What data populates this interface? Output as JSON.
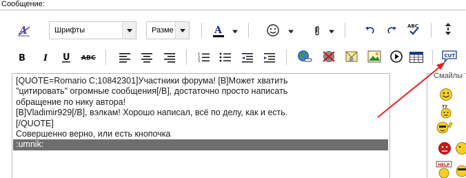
{
  "header": {
    "label": "Сообщение:"
  },
  "toolbar": {
    "font_select": {
      "value": "Шрифты"
    },
    "size_select": {
      "value": "Разме"
    },
    "buttons_row1": [
      "remove-format",
      "font-color",
      "smilies",
      "attach",
      "undo",
      "redo",
      "spellcheck",
      "resize"
    ],
    "buttons_row2": [
      "bold",
      "italic",
      "underline",
      "strikethrough",
      "align-left",
      "align-center",
      "align-right",
      "ordered-list",
      "unordered-list",
      "indent",
      "outdent",
      "insert-link",
      "remove-link",
      "email",
      "insert-image",
      "insert-video",
      "table",
      "cut"
    ],
    "cut_label": "CUT"
  },
  "editor": {
    "lines": [
      "[QUOTE=Romario C;10842301]Участники форума! [B]Может хватить",
      "\"цитировать\" огромные сообщения[/B], достаточно просто написать",
      "обращение по нику автора!",
      "[B]Vladimir929[/B], вэлкам! Хорошо написал, всё по делу, как и есть.",
      "[/QUOTE]",
      "Совершенно верно, или есть кнопочка",
      ":umnik:"
    ]
  },
  "smilies_panel": {
    "title": "Смайлы"
  },
  "annotation": {
    "arrow_color": "#e8201c"
  },
  "colors": {
    "selection": "#6e6e6e",
    "border": "#b8b8b8",
    "font_color_bar": "#000000"
  }
}
